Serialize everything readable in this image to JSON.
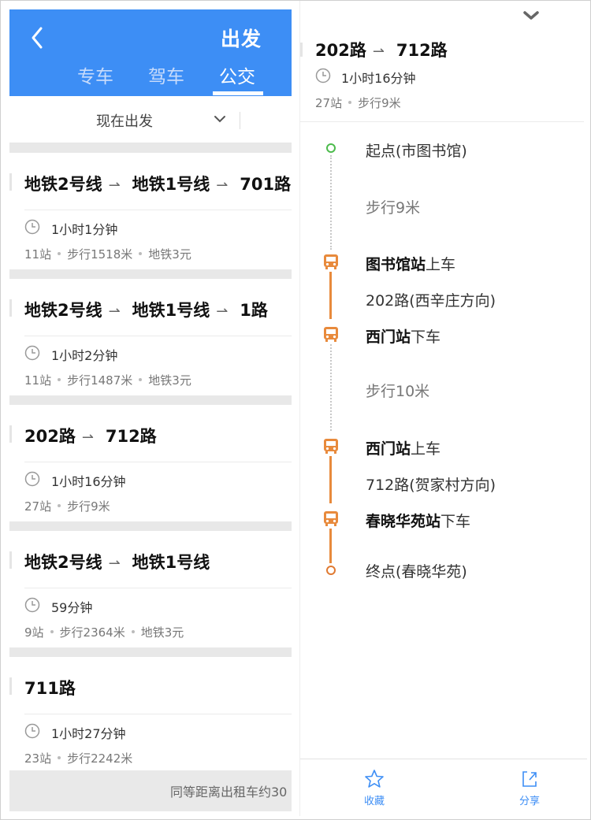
{
  "header": {
    "title": "出发",
    "tabs": [
      {
        "label": "专车",
        "active": false
      },
      {
        "label": "驾车",
        "active": false
      },
      {
        "label": "公交",
        "active": true
      }
    ]
  },
  "depart_option": "现在出发",
  "routes": [
    {
      "segments": [
        "地铁2号线",
        "地铁1号线",
        "701路"
      ],
      "duration": "1小时1分钟",
      "stops": "11站",
      "walk": "步行1518米",
      "fare": "地铁3元"
    },
    {
      "segments": [
        "地铁2号线",
        "地铁1号线",
        "1路"
      ],
      "duration": "1小时2分钟",
      "stops": "11站",
      "walk": "步行1487米",
      "fare": "地铁3元"
    },
    {
      "segments": [
        "202路",
        "712路"
      ],
      "duration": "1小时16分钟",
      "stops": "27站",
      "walk": "步行9米",
      "fare": ""
    },
    {
      "segments": [
        "地铁2号线",
        "地铁1号线"
      ],
      "duration": "59分钟",
      "stops": "9站",
      "walk": "步行2364米",
      "fare": "地铁3元"
    },
    {
      "segments": [
        "711路"
      ],
      "duration": "1小时27分钟",
      "stops": "23站",
      "walk": "步行2242米",
      "fare": ""
    }
  ],
  "taxi_note": "同等距离出租车约30",
  "detail": {
    "segments": [
      "202路",
      "712路"
    ],
    "duration": "1小时16分钟",
    "stops": "27站",
    "walk": "步行9米",
    "steps": {
      "start": "起点(市图书馆)",
      "walk1": "步行9米",
      "board1_station": "图书馆站",
      "board1_action": "上车",
      "line1": "202路(西辛庄方向)",
      "alight1_station": "西门站",
      "alight1_action": "下车",
      "walk2": "步行10米",
      "board2_station": "西门站",
      "board2_action": "上车",
      "line2": "712路(贺家村方向)",
      "alight2_station": "春晓华苑站",
      "alight2_action": "下车",
      "end": "终点(春晓华苑)"
    },
    "actions": {
      "favorite": "收藏",
      "share": "分享"
    }
  },
  "colors": {
    "header_blue": "#3d8ef5",
    "bus_orange": "#e88a3c",
    "start_green": "#4cbb4c"
  }
}
